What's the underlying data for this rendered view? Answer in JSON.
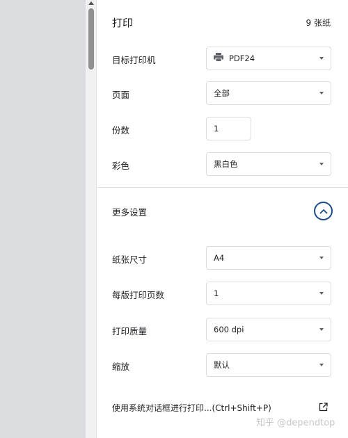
{
  "header": {
    "title": "打印",
    "sheet_count": "9 张纸"
  },
  "settings": {
    "destination": {
      "label": "目标打印机",
      "value": "PDF24",
      "icon": "printer-icon"
    },
    "pages": {
      "label": "页面",
      "value": "全部"
    },
    "copies": {
      "label": "份数",
      "value": "1"
    },
    "color": {
      "label": "彩色",
      "value": "黑白色"
    }
  },
  "more_settings": {
    "label": "更多设置",
    "expanded": true,
    "paper_size": {
      "label": "纸张尺寸",
      "value": "A4"
    },
    "pages_per_sheet": {
      "label": "每版打印页数",
      "value": "1"
    },
    "quality": {
      "label": "打印质量",
      "value": "600 dpi"
    },
    "scale": {
      "label": "缩放",
      "value": "默认"
    }
  },
  "system_dialog": {
    "label": "使用系统对话框进行打印...(Ctrl+Shift+P)",
    "icon": "open-in-new-icon"
  },
  "watermark": "知乎 @dependtop",
  "colors": {
    "accent": "#1a4a8a",
    "border": "#dadce0",
    "sidebar": "#dadce0"
  }
}
